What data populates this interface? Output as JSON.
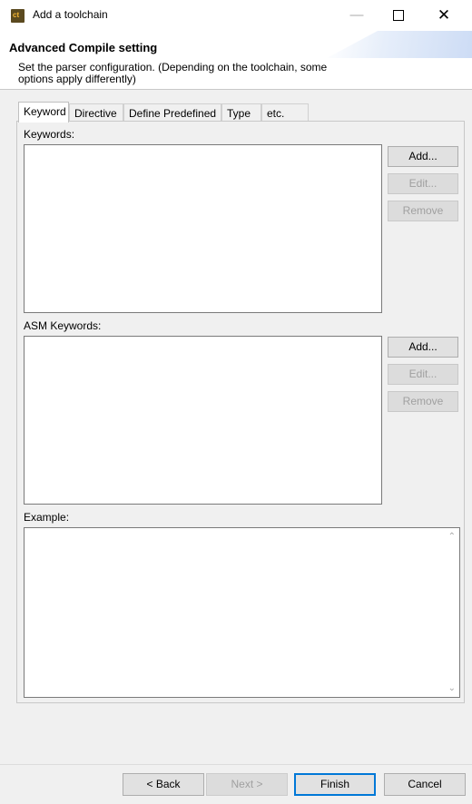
{
  "window": {
    "title": "Add a toolchain",
    "icon_text": "ct",
    "minimize": "—",
    "close": "✕"
  },
  "header": {
    "title": "Advanced Compile setting",
    "description": "Set the parser configuration. (Depending on the toolchain, some options apply differently)"
  },
  "tabs": [
    {
      "label": "Keyword",
      "active": true
    },
    {
      "label": "Directive"
    },
    {
      "label": "Define Predefined"
    },
    {
      "label": "Type"
    },
    {
      "label": "etc."
    }
  ],
  "keywords": {
    "label": "Keywords:",
    "add": "Add...",
    "edit": "Edit...",
    "remove": "Remove"
  },
  "asm_keywords": {
    "label": "ASM Keywords:",
    "add": "Add...",
    "edit": "Edit...",
    "remove": "Remove"
  },
  "example": {
    "label": "Example:",
    "up_arrow": "⌃",
    "down_arrow": "⌄"
  },
  "footer": {
    "back": "< Back",
    "next": "Next >",
    "finish": "Finish",
    "cancel": "Cancel"
  }
}
